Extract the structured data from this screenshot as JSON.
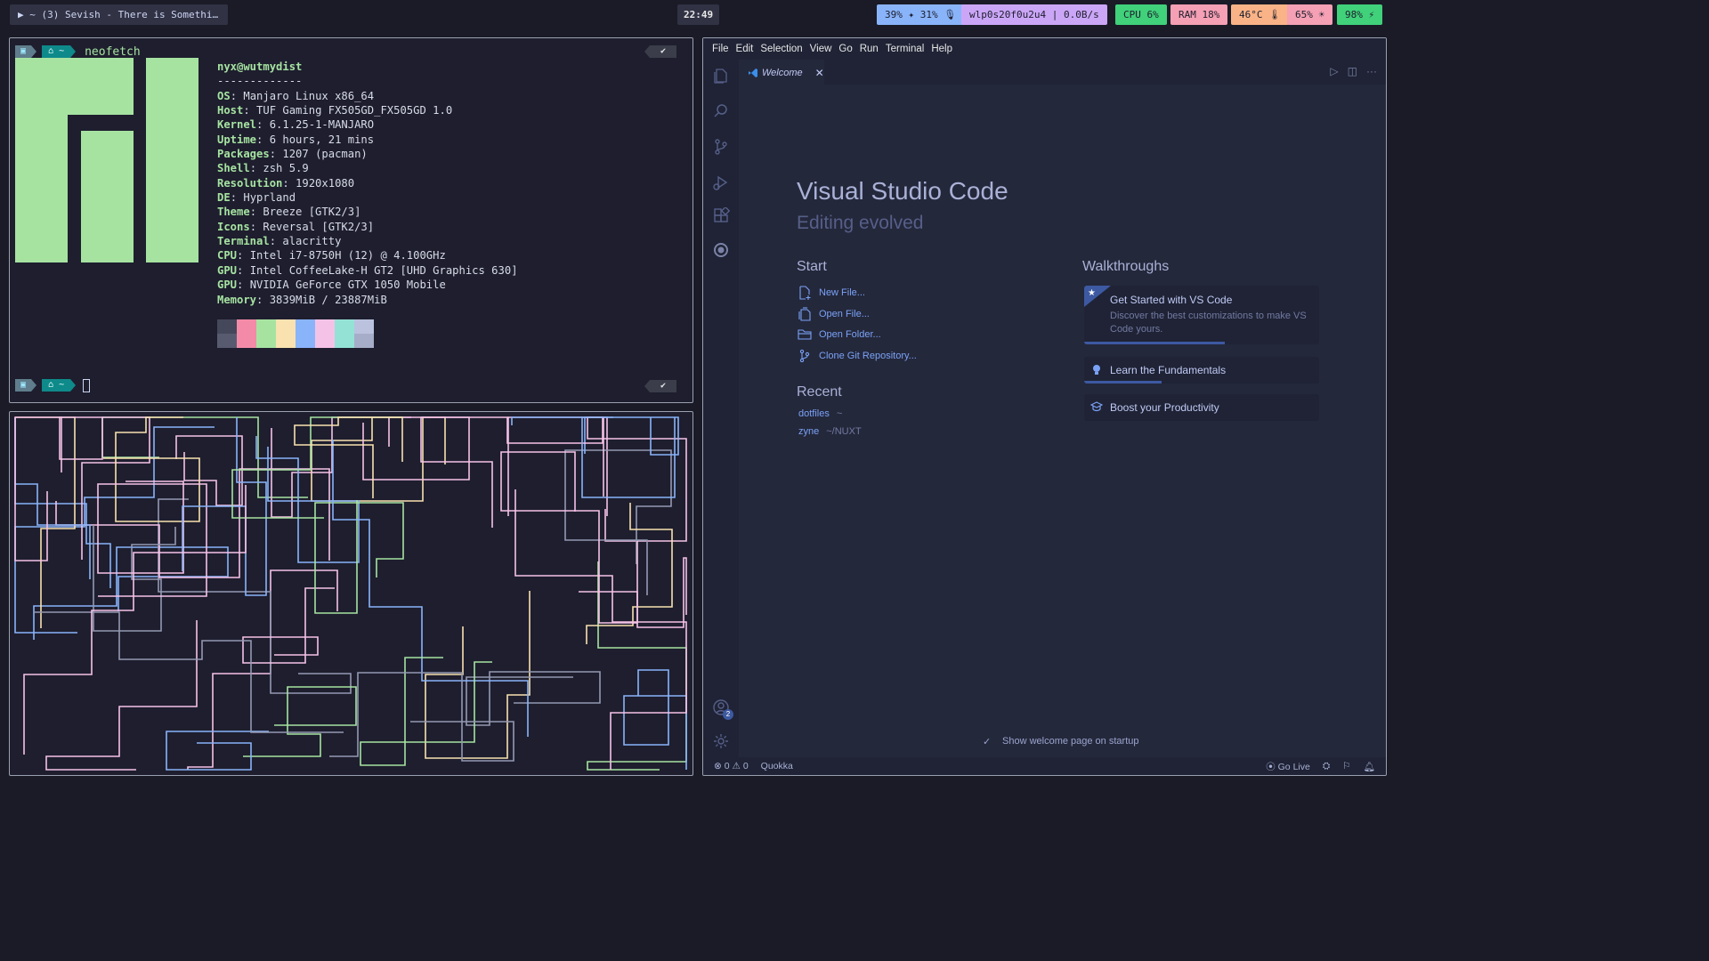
{
  "topbar": {
    "media": "▶  ~ (3) Sevish - There is Somethi…",
    "clock": "22:49",
    "audio": "39% ✦ 31% 🎙",
    "network": "wlp0s20f0u2u4 | 0.0B/s",
    "cpu": "CPU 6%",
    "ram": "RAM 18%",
    "temperature": "46°C 🌡",
    "brightness": "65% ☀",
    "battery": "98% ⚡"
  },
  "terminal1": {
    "prompt_home": "⌂ ~",
    "command": "neofetch",
    "ok": "✔",
    "user_host": "nyx@wutmydist",
    "separator": "-------------",
    "info": [
      {
        "label": "OS",
        "value": ": Manjaro Linux x86_64"
      },
      {
        "label": "Host",
        "value": ": TUF Gaming FX505GD_FX505GD 1.0"
      },
      {
        "label": "Kernel",
        "value": ": 6.1.25-1-MANJARO"
      },
      {
        "label": "Uptime",
        "value": ": 6 hours, 21 mins"
      },
      {
        "label": "Packages",
        "value": ": 1207 (pacman)"
      },
      {
        "label": "Shell",
        "value": ": zsh 5.9"
      },
      {
        "label": "Resolution",
        "value": ": 1920x1080"
      },
      {
        "label": "DE",
        "value": ": Hyprland"
      },
      {
        "label": "Theme",
        "value": ": Breeze [GTK2/3]"
      },
      {
        "label": "Icons",
        "value": ": Reversal [GTK2/3]"
      },
      {
        "label": "Terminal",
        "value": ": alacritty"
      },
      {
        "label": "CPU",
        "value": ": Intel i7-8750H (12) @ 4.100GHz"
      },
      {
        "label": "GPU",
        "value": ": Intel CoffeeLake-H GT2 [UHD Graphics 630]"
      },
      {
        "label": "GPU",
        "value": ": NVIDIA GeForce GTX 1050 Mobile"
      },
      {
        "label": "Memory",
        "value": ": 3839MiB / 23887MiB"
      }
    ],
    "palette": [
      [
        "#45475a",
        "#585b70"
      ],
      [
        "#f38ba8",
        "#f38ba8"
      ],
      [
        "#a6e3a1",
        "#a6e3a1"
      ],
      [
        "#f9e2af",
        "#f9e2af"
      ],
      [
        "#89b4fa",
        "#89b4fa"
      ],
      [
        "#f5c2e7",
        "#f5c2e7"
      ],
      [
        "#94e2d5",
        "#94e2d5"
      ],
      [
        "#bac2de",
        "#a6adc8"
      ]
    ],
    "logo_color": "#a6e3a1"
  },
  "vscode": {
    "menu": [
      "File",
      "Edit",
      "Selection",
      "View",
      "Go",
      "Run",
      "Terminal",
      "Help"
    ],
    "tab_label": "Welcome",
    "title": "Visual Studio Code",
    "subtitle": "Editing evolved",
    "start_heading": "Start",
    "start_items": [
      "New File...",
      "Open File...",
      "Open Folder...",
      "Clone Git Repository..."
    ],
    "recent_heading": "Recent",
    "recent": [
      {
        "name": "dotfiles",
        "path": "~"
      },
      {
        "name": "zyne",
        "path": "~/NUXT"
      }
    ],
    "walkthroughs_heading": "Walkthroughs",
    "walk1_title": "Get Started with VS Code",
    "walk1_desc": "Discover the best customizations to make VS Code yours.",
    "walk1_progress": 0.6,
    "walk2_title": "Learn the Fundamentals",
    "walk2_progress": 0.33,
    "walk3_title": "Boost your Productivity",
    "show_welcome": "Show welcome page on startup",
    "accounts_badge": "2",
    "status": {
      "errors": "0",
      "warnings": "0",
      "quokka": "Quokka",
      "golive": "Go Live"
    },
    "accent": "#7aa2f7"
  }
}
